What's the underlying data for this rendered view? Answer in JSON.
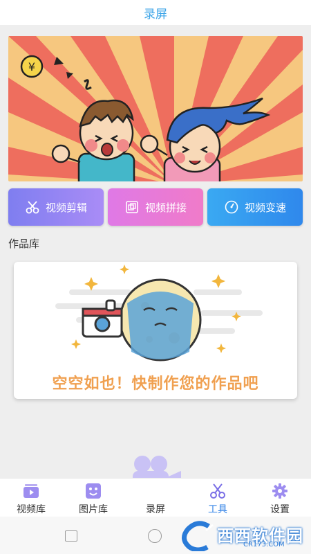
{
  "header": {
    "title": "录屏"
  },
  "tools": [
    {
      "label": "视频剪辑",
      "icon": "scissors-icon"
    },
    {
      "label": "视频拼接",
      "icon": "join-icon"
    },
    {
      "label": "视频变速",
      "icon": "speed-icon"
    }
  ],
  "section": {
    "title": "作品库"
  },
  "empty_state": {
    "message": "空空如也！快制作您的作品吧"
  },
  "bottom_nav": {
    "items": [
      {
        "label": "视频库",
        "icon": "video-library-icon",
        "active": false
      },
      {
        "label": "图片库",
        "icon": "image-library-icon",
        "active": false
      },
      {
        "label": "录屏",
        "icon": "record-camera-icon",
        "active": false
      },
      {
        "label": "工具",
        "icon": "tools-scissors-icon",
        "active": true
      },
      {
        "label": "设置",
        "icon": "settings-gear-icon",
        "active": false
      }
    ]
  },
  "watermark": {
    "main": "西西软件园",
    "sub": "CR173.COM"
  },
  "colors": {
    "accent": "#2f80e6",
    "title": "#3fa6e8",
    "empty_text": "#f0a050",
    "btn_edit": "#8f84f2",
    "btn_join": "#e87ad8",
    "btn_speed": "#3499ef"
  }
}
